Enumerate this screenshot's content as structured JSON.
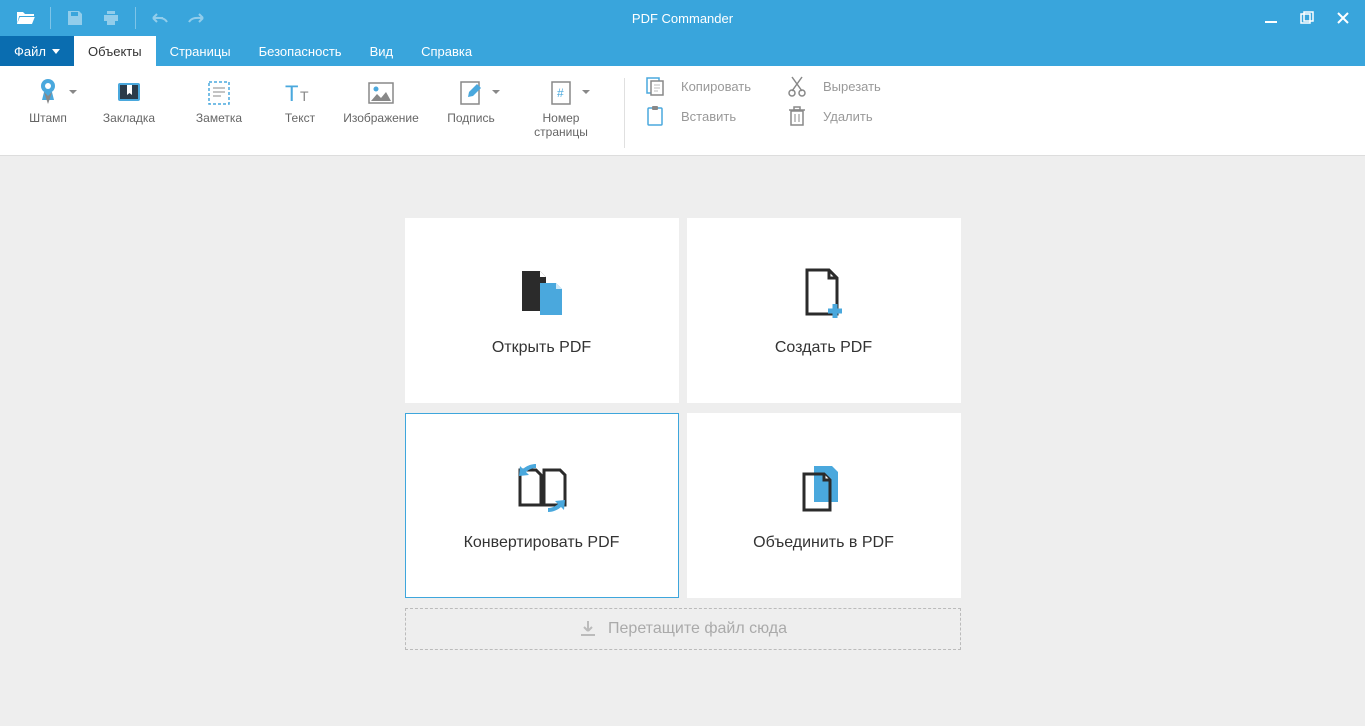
{
  "app": {
    "title": "PDF Commander"
  },
  "menu": {
    "file": "Файл",
    "objects": "Объекты",
    "pages": "Страницы",
    "security": "Безопасность",
    "view": "Вид",
    "help": "Справка"
  },
  "ribbon": {
    "stamp": "Штамп",
    "bookmark": "Закладка",
    "note": "Заметка",
    "text": "Текст",
    "image": "Изображение",
    "signature": "Подпись",
    "page_number": "Номер\nстраницы",
    "copy": "Копировать",
    "cut": "Вырезать",
    "paste": "Вставить",
    "delete": "Удалить"
  },
  "cards": {
    "open": "Открыть PDF",
    "create": "Создать PDF",
    "convert": "Конвертировать PDF",
    "merge": "Объединить в PDF"
  },
  "dropzone": {
    "label": "Перетащите файл сюда"
  }
}
